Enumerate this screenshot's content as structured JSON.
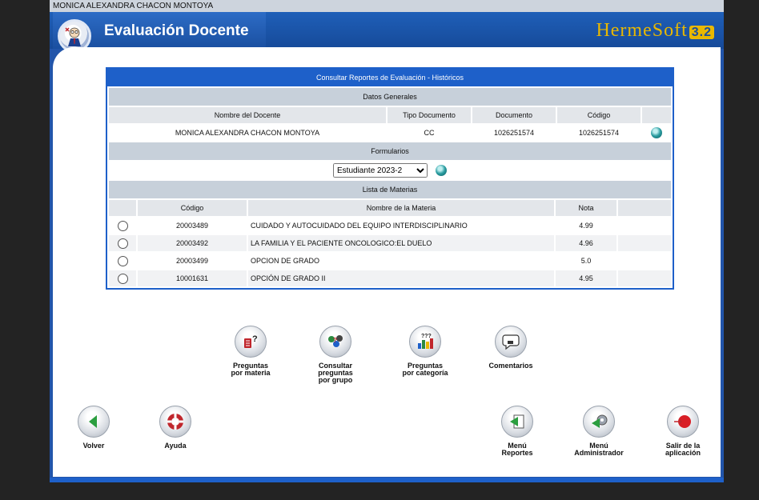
{
  "user_name": "MONICA ALEXANDRA CHACON MONTOYA",
  "app": {
    "title": "Evaluación Docente",
    "brand": "HermeSoft",
    "version": "3.2"
  },
  "panel": {
    "title": "Consultar Reportes de Evaluación - Históricos",
    "general_section": "Datos Generales",
    "general_headers": [
      "Nombre del Docente",
      "Tipo Documento",
      "Documento",
      "Código"
    ],
    "general_row": {
      "name": "MONICA ALEXANDRA CHACON MONTOYA",
      "doc_type": "CC",
      "document": "1026251574",
      "code": "1026251574"
    },
    "forms_section": "Formularios",
    "form_selected": "Estudiante 2023-2",
    "subjects_section": "Lista de Materias",
    "subjects_headers": [
      "Código",
      "Nombre de la Materia",
      "Nota"
    ],
    "subjects": [
      {
        "code": "20003489",
        "name": "CUIDADO Y AUTOCUIDADO DEL EQUIPO INTERDISCIPLINARIO",
        "grade": "4.99"
      },
      {
        "code": "20003492",
        "name": "LA FAMILIA Y EL PACIENTE ONCOLOGICO:EL DUELO",
        "grade": "4.96"
      },
      {
        "code": "20003499",
        "name": "OPCION DE GRADO",
        "grade": "5.0"
      },
      {
        "code": "10001631",
        "name": "OPCIÓN DE GRADO II",
        "grade": "4.95"
      }
    ]
  },
  "actions": {
    "by_subject": [
      "Preguntas",
      "por materia"
    ],
    "by_group": [
      "Consultar",
      "preguntas",
      "por grupo"
    ],
    "by_category": [
      "Preguntas",
      "por categoría"
    ],
    "comments": [
      "Comentarios"
    ]
  },
  "nav": {
    "back": "Volver",
    "help": "Ayuda",
    "reports_menu": [
      "Menú",
      "Reportes"
    ],
    "admin_menu": [
      "Menú",
      "Administrador"
    ],
    "exit": [
      "Salir de la",
      "aplicación"
    ]
  },
  "colors": {
    "header_blue": "#1e60c9",
    "section_gray": "#c7d0da",
    "brand_gold": "#e9b800"
  }
}
